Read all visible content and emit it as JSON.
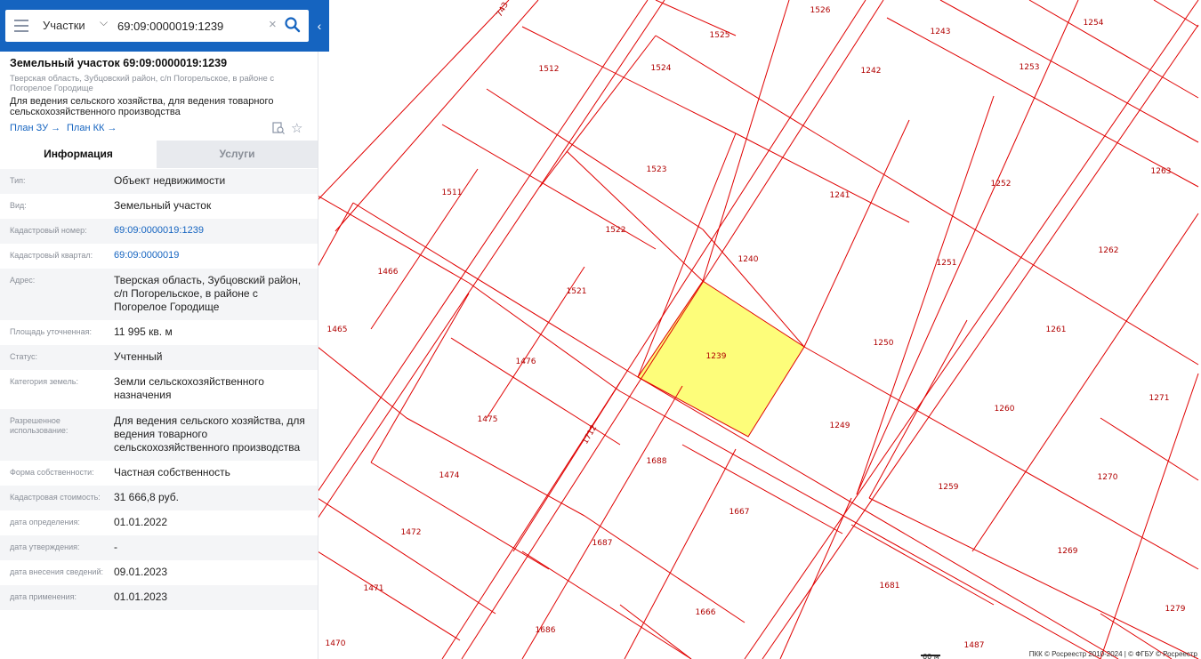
{
  "search": {
    "type_label": "Участки",
    "query": "69:09:0000019:1239"
  },
  "object": {
    "title": "Земельный участок 69:09:0000019:1239",
    "address_short": "Тверская область, Зубцовский район, с/п Погорельское, в районе с Погорелое Городище",
    "use": "Для ведения сельского хозяйства, для ведения товарного сельскохозяйственного производства",
    "link_zu": "План ЗУ →",
    "link_kk": "План КК →"
  },
  "tabs": {
    "info": "Информация",
    "services": "Услуги"
  },
  "rows": [
    {
      "label": "Тип:",
      "value": "Объект недвижимости",
      "link": false
    },
    {
      "label": "Вид:",
      "value": "Земельный участок",
      "link": false
    },
    {
      "label": "Кадастровый номер:",
      "value": "69:09:0000019:1239",
      "link": true
    },
    {
      "label": "Кадастровый квартал:",
      "value": "69:09:0000019",
      "link": true
    },
    {
      "label": "Адрес:",
      "value": "Тверская область, Зубцовский район, с/п Погорельское, в районе с Погорелое Городище",
      "link": false
    },
    {
      "label": "Площадь уточненная:",
      "value": "11 995 кв. м",
      "link": false
    },
    {
      "label": "Статус:",
      "value": "Учтенный",
      "link": false
    },
    {
      "label": "Категория земель:",
      "value": "Земли сельскохозяйственного назначения",
      "link": false
    },
    {
      "label": "Разрешенное использование:",
      "value": "Для ведения сельского хозяйства, для ведения товарного сельскохозяйственного производства",
      "link": false
    },
    {
      "label": "Форма собственности:",
      "value": "Частная собственность",
      "link": false
    },
    {
      "label": "Кадастровая стоимость:",
      "value": "31 666,8 руб.",
      "link": false
    },
    {
      "label": "дата определения:",
      "value": "01.01.2022",
      "link": false
    },
    {
      "label": "дата утверждения:",
      "value": "-",
      "link": false
    },
    {
      "label": "дата внесения сведений:",
      "value": "09.01.2023",
      "link": false
    },
    {
      "label": "дата применения:",
      "value": "01.01.2023",
      "link": false
    }
  ],
  "map": {
    "selected_parcel": "1239",
    "selected_fill": "#fdfd7a",
    "line_color": "#e00000",
    "parcel_labels": [
      "743",
      "1526",
      "1243",
      "1254",
      "1525",
      "1512",
      "1524",
      "1242",
      "1253",
      "1511",
      "1523",
      "1241",
      "1252",
      "1263",
      "1522",
      "1240",
      "1251",
      "1262",
      "1466",
      "1521",
      "1250",
      "1465",
      "1261",
      "1476",
      "1249",
      "1260",
      "1271",
      "1475",
      "1712",
      "1688",
      "1259",
      "1270",
      "1474",
      "1667",
      "1472",
      "1687",
      "1269",
      "1681",
      "1471",
      "1666",
      "1279",
      "1686",
      "1470",
      "1487"
    ],
    "scale": "60 м",
    "footer": "ПКК © Росреестр 2010-2024 | © ФГБУ © Росреестр"
  }
}
